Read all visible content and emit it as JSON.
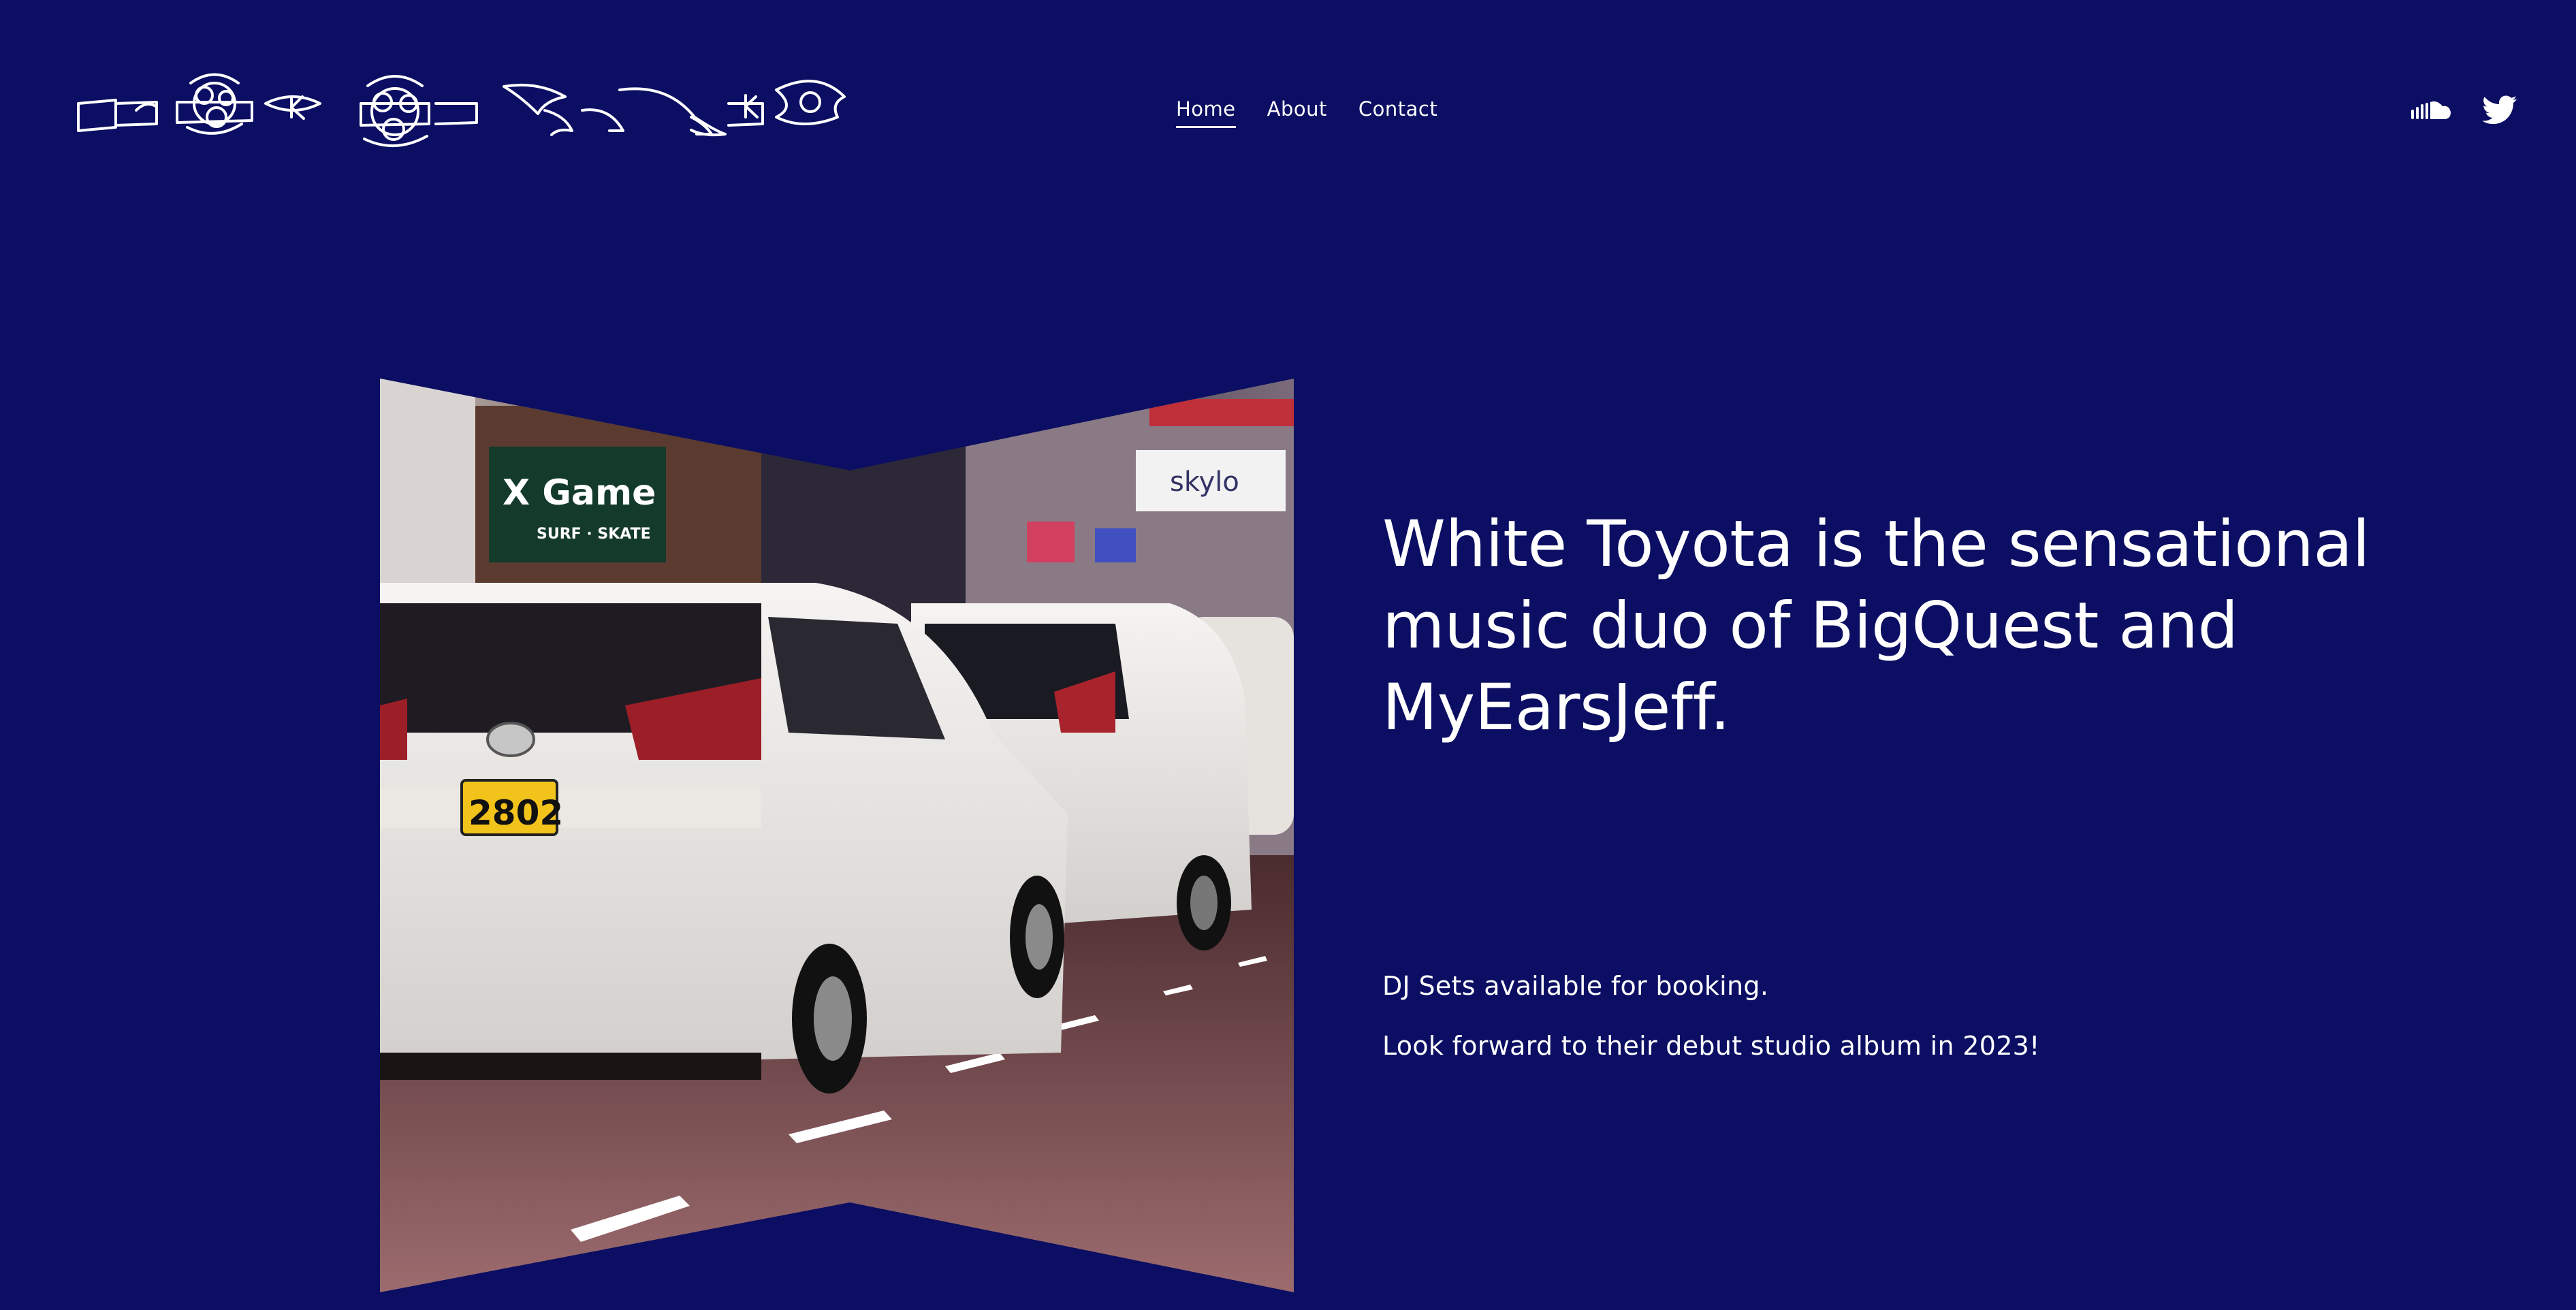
{
  "site": {
    "brand_colors": {
      "background": "#0b0e62",
      "text": "#ffffff"
    }
  },
  "header": {
    "logo_icon": "ornamental-banner-logo",
    "nav": [
      {
        "label": "Home",
        "active": true
      },
      {
        "label": "About",
        "active": false
      },
      {
        "label": "Contact",
        "active": false
      }
    ],
    "social": [
      {
        "icon": "soundcloud-icon"
      },
      {
        "icon": "twitter-icon"
      }
    ]
  },
  "hero": {
    "image": {
      "license_plate": "2802",
      "sign_game": "X Game",
      "sign_sub": "SURF · SKATE",
      "sign_sky": "skylo"
    },
    "headline": "White Toyota is the sensational music duo of BigQuest and MyEarsJeff.",
    "lines": [
      "DJ Sets available for booking.",
      "Look forward to their debut studio album in 2023!"
    ]
  }
}
